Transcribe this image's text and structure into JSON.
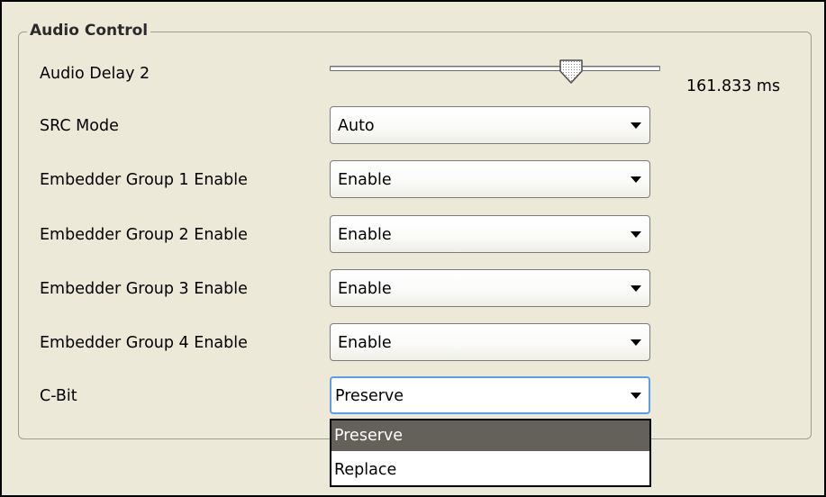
{
  "group": {
    "title": "Audio Control"
  },
  "audio_delay": {
    "label": "Audio Delay 2",
    "value_text": "161.833 ms",
    "slider_fraction": 0.73
  },
  "rows": [
    {
      "label": "SRC Mode",
      "value": "Auto"
    },
    {
      "label": "Embedder Group 1 Enable",
      "value": "Enable"
    },
    {
      "label": "Embedder Group 2 Enable",
      "value": "Enable"
    },
    {
      "label": "Embedder Group 3 Enable",
      "value": "Enable"
    },
    {
      "label": "Embedder Group 4 Enable",
      "value": "Enable"
    },
    {
      "label": "C-Bit",
      "value": "Preserve"
    }
  ],
  "dropdown": {
    "options": [
      "Preserve",
      "Replace"
    ],
    "highlighted": "Preserve"
  },
  "icons": {
    "slider_thumb": "slider-thumb-icon",
    "dropdown_arrow": "chevron-down-icon"
  },
  "colors": {
    "panel_background": "#ece9d8",
    "focus_border": "#5c9fe4",
    "highlight": "#64615b"
  }
}
